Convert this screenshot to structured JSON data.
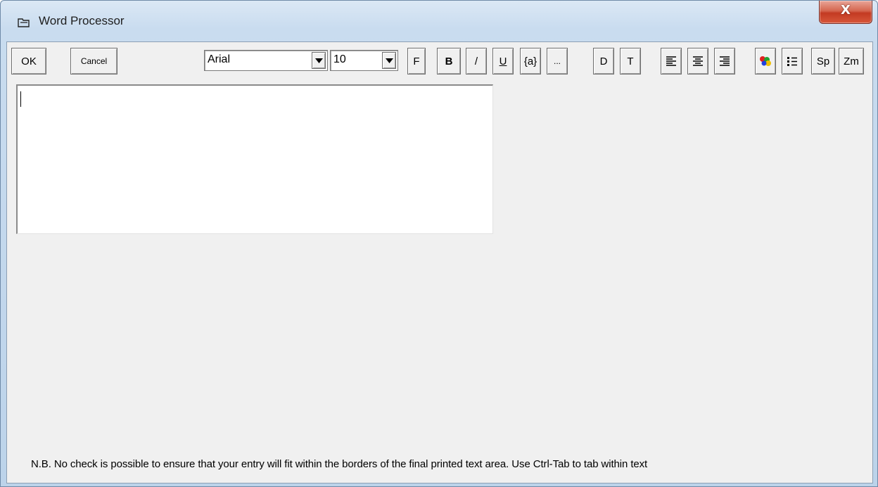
{
  "window": {
    "title": "Word Processor",
    "close_label": "X"
  },
  "toolbar": {
    "ok": "OK",
    "cancel": "Cancel",
    "font_name": "Arial",
    "font_size": "10",
    "font_dialog": "F",
    "bold": "B",
    "italic": "/",
    "underline": "U",
    "field": "{a}",
    "more": "...",
    "date": "D",
    "time": "T",
    "spell": "Sp",
    "zoom": "Zm",
    "icons": {
      "align_left": "align-left-icon",
      "align_center": "align-center-icon",
      "align_right": "align-right-icon",
      "color": "text-color-icon",
      "bullets": "bullet-list-icon"
    }
  },
  "editor": {
    "text": ""
  },
  "footer": {
    "note": "N.B. No check is possible to ensure that your entry will fit within the borders of the final printed text area.   Use Ctrl-Tab to tab within text"
  }
}
